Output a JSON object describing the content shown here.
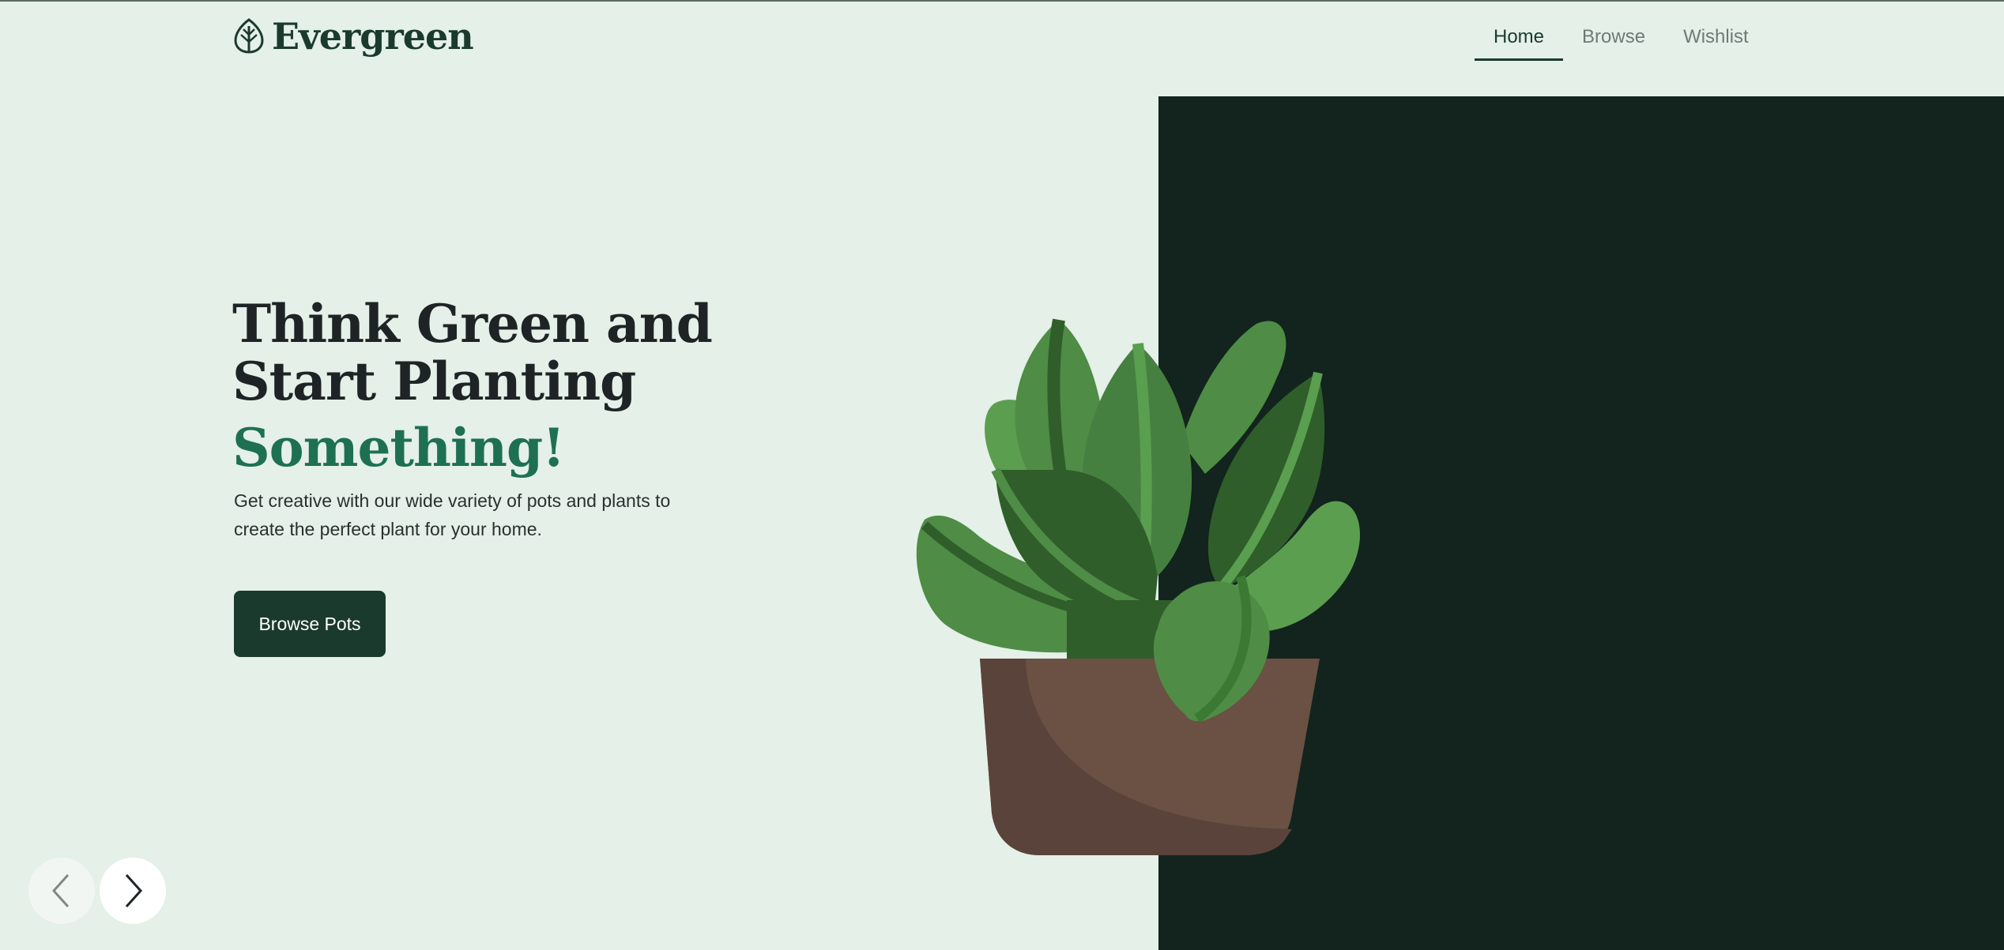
{
  "brand": {
    "name": "Evergreen",
    "logo_icon": "leaf-icon"
  },
  "nav": {
    "items": [
      {
        "label": "Home",
        "active": true
      },
      {
        "label": "Browse",
        "active": false
      },
      {
        "label": "Wishlist",
        "active": false
      }
    ]
  },
  "hero": {
    "title": "Think Green and Start Planting",
    "title_accent": "Something!",
    "description": "Get creative with our wide variety of pots and plants to create the perfect plant for your home.",
    "cta_label": "Browse Pots",
    "image": "potted-plant-illustration"
  },
  "carousel": {
    "prev_icon": "chevron-left-icon",
    "next_icon": "chevron-right-icon"
  },
  "colors": {
    "background": "#e4f0e8",
    "dark_panel": "#12241d",
    "brand_dark": "#1b3a2e",
    "accent_green": "#1e7052",
    "pot_brown": "#6b5044"
  }
}
